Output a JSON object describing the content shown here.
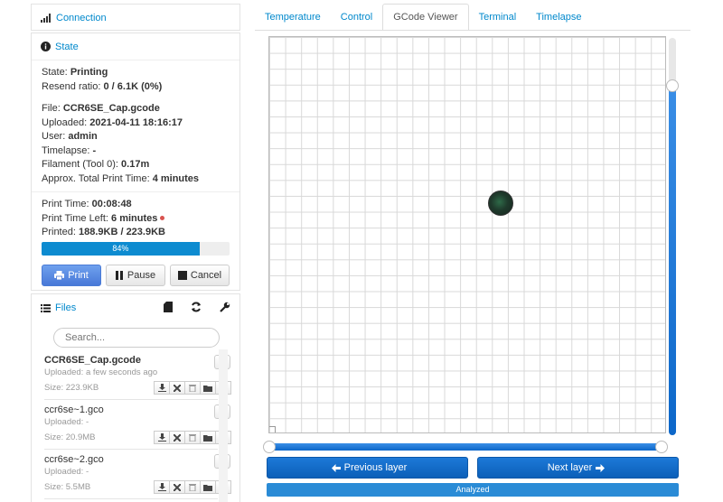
{
  "connection": {
    "title": "Connection",
    "icon": "signal-icon"
  },
  "state": {
    "title": "State",
    "icon": "info-circle-icon",
    "state_label": "State:",
    "state_value": "Printing",
    "resend_label": "Resend ratio:",
    "resend_value": "0 / 6.1K (0%)",
    "file_label": "File:",
    "file_value": "CCR6SE_Cap.gcode",
    "uploaded_label": "Uploaded:",
    "uploaded_value": "2021-04-11 18:16:17",
    "user_label": "User:",
    "user_value": "admin",
    "timelapse_label": "Timelapse:",
    "timelapse_value": "-",
    "filament_label": "Filament (Tool 0):",
    "filament_value": "0.17m",
    "approx_label": "Approx. Total Print Time:",
    "approx_value": "4 minutes",
    "print_time_label": "Print Time:",
    "print_time_value": "00:08:48",
    "time_left_label": "Print Time Left:",
    "time_left_value": "6 minutes",
    "printed_label": "Printed:",
    "printed_value": "188.9KB / 223.9KB",
    "progress_text": "84%",
    "progress_fraction": 0.84,
    "buttons": {
      "print": "Print",
      "pause": "Pause",
      "cancel": "Cancel"
    }
  },
  "files": {
    "title": "Files",
    "icon": "list-icon",
    "search_placeholder": "Search...",
    "items": [
      {
        "name": "CCR6SE_Cap.gcode",
        "uploaded": "Uploaded: a few seconds ago",
        "size": "Size: 223.9KB"
      },
      {
        "name": "ccr6se~1.gco",
        "uploaded": "Uploaded: -",
        "size": "Size: 20.9MB"
      },
      {
        "name": "ccr6se~2.gco",
        "uploaded": "Uploaded: -",
        "size": "Size: 5.5MB"
      }
    ]
  },
  "tabs": [
    "Temperature",
    "Control",
    "GCode Viewer",
    "Terminal",
    "Timelapse"
  ],
  "active_tab": "GCode Viewer",
  "viewer": {
    "layer_fraction": 0.88,
    "hslider_fraction": 1.0,
    "prev_layer": "Previous layer",
    "next_layer": "Next layer",
    "analyzed": "Analyzed"
  },
  "colors": {
    "link": "#0088cc",
    "primary": "#4878d8",
    "slider": "#0c67c9",
    "progress": "#0d8bd0"
  }
}
